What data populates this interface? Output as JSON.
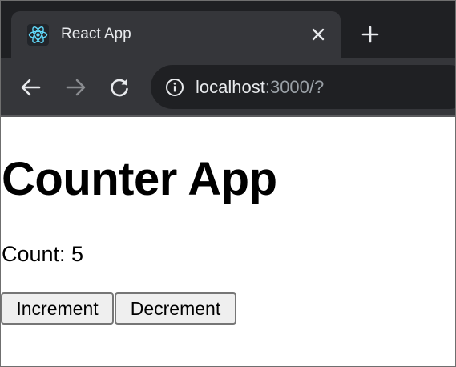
{
  "browser": {
    "tab": {
      "title": "React App",
      "favicon": "react-logo-icon"
    },
    "address_bar": {
      "host": "localhost",
      "rest": ":3000/?"
    },
    "icons": {
      "close": "close-icon",
      "new_tab": "plus-icon",
      "back": "arrow-left-icon",
      "forward": "arrow-right-icon",
      "reload": "reload-icon",
      "info": "info-icon"
    },
    "colors": {
      "tabstrip": "#1f2023",
      "toolbar": "#35363a",
      "react_blue": "#61dafb"
    }
  },
  "page": {
    "title": "Counter App",
    "count_text": "Count: 5",
    "buttons": {
      "increment": "Increment",
      "decrement": "Decrement"
    }
  }
}
